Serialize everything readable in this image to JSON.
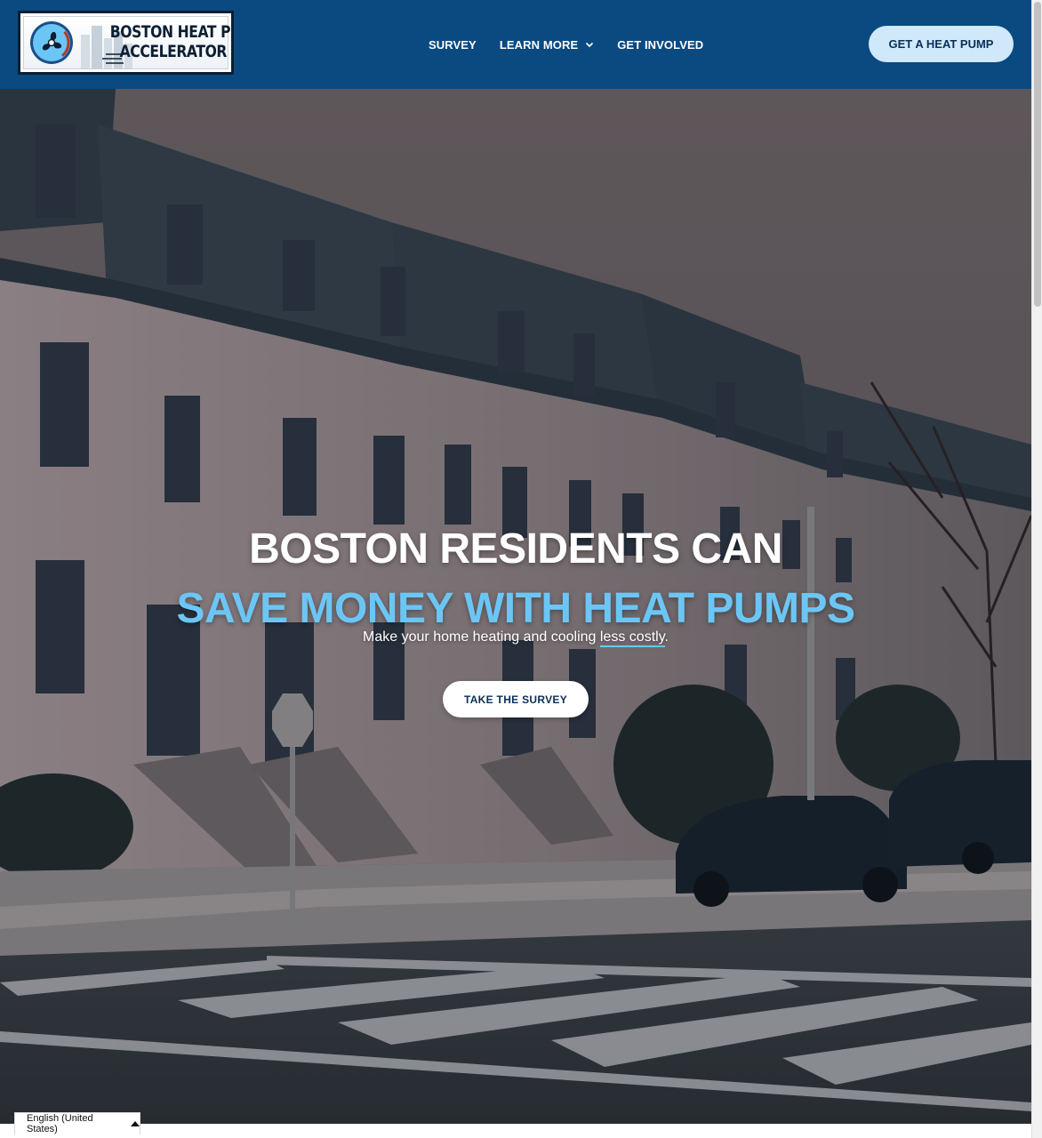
{
  "header": {
    "logo": {
      "line1": "BOSTON HEAT PUMP",
      "line2": "ACCELERATOR"
    },
    "nav": [
      {
        "label": "SURVEY",
        "has_dropdown": false
      },
      {
        "label": "LEARN MORE",
        "has_dropdown": true
      },
      {
        "label": "GET INVOLVED",
        "has_dropdown": false
      }
    ],
    "cta_label": "GET A HEAT PUMP"
  },
  "hero": {
    "title_line1": "BOSTON RESIDENTS CAN",
    "title_line2": "SAVE MONEY WITH HEAT PUMPS",
    "subtitle_before": "Make your home heating and cooling ",
    "subtitle_emphasis": "less costly",
    "subtitle_after": ".",
    "button_label": "TAKE THE SURVEY",
    "background_icon": "rowhouses-street-photo"
  },
  "language_selector": {
    "label": "English (United States)",
    "icon": "caret-up-icon"
  },
  "colors": {
    "header_bg": "#0a4a80",
    "accent_blue": "#6cc6f5",
    "cta_bg": "#cfe9fb",
    "cta_text": "#0b2f55"
  }
}
